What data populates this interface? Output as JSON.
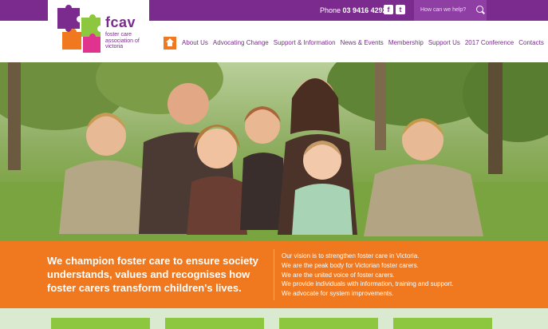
{
  "header": {
    "phone_label": "Phone",
    "phone_number": "03 9416 4292",
    "search_placeholder": "How can we help?"
  },
  "logo": {
    "brand": "fcav",
    "tagline": "foster care association of victoria"
  },
  "nav": {
    "items": [
      "About Us",
      "Advocating Change",
      "Support & Information",
      "News & Events",
      "Membership",
      "Support Us",
      "2017 Conference",
      "Contacts"
    ]
  },
  "band": {
    "headline": "We champion foster care to ensure society understands, values and recognises how foster carers transform children's lives.",
    "points": [
      "Our vision is to strengthen foster care in Victoria.",
      "We are the peak body for Victorian foster carers.",
      "We are the united voice of foster carers.",
      "We provide individuals with information, training and support.",
      "We advocate for system improvements."
    ]
  },
  "colors": {
    "purple": "#7b2b8e",
    "orange": "#f0781e",
    "green": "#8dc63f",
    "pink": "#e0338f"
  }
}
